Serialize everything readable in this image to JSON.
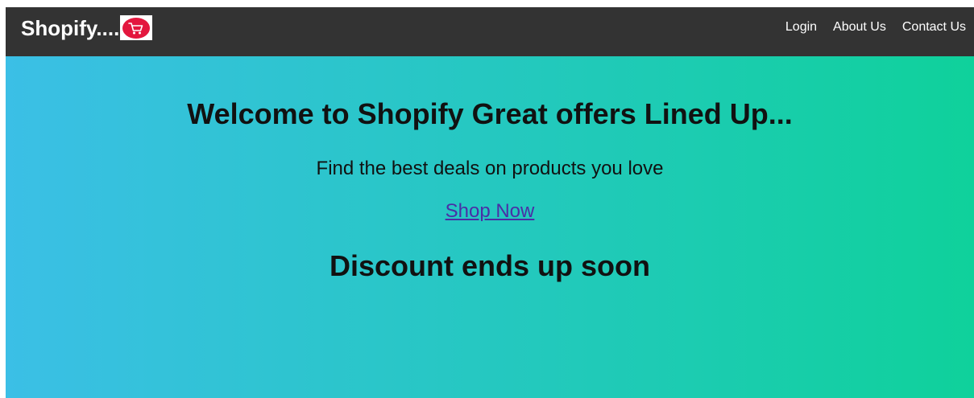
{
  "navbar": {
    "brand": "Shopify....",
    "logo_icon": "shopping-cart-icon",
    "links": [
      "Login",
      "About Us",
      "Contact Us"
    ]
  },
  "hero": {
    "title": "Welcome to Shopify Great offers Lined Up...",
    "subtitle": "Find the best deals on products you love",
    "cta": "Shop Now",
    "discount": "Discount ends up soon"
  },
  "colors": {
    "navbar_bg": "#333333",
    "gradient_start": "#3bbfe6",
    "gradient_end": "#0fd19b",
    "logo_red": "#e3173e",
    "link_color": "#4a2fa6"
  }
}
